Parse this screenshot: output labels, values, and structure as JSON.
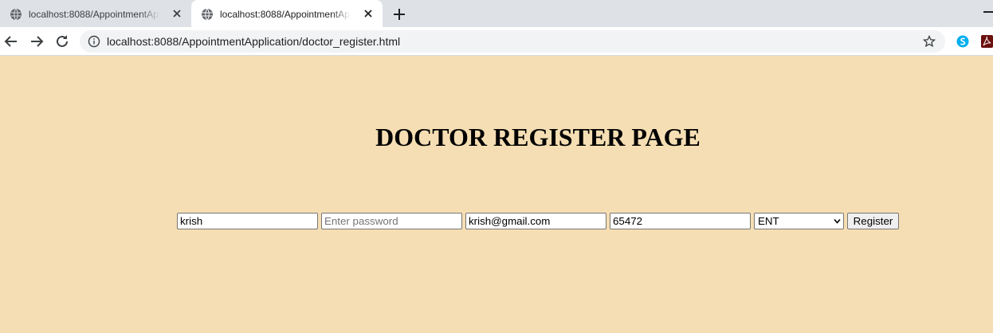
{
  "browser": {
    "tabs": [
      {
        "title": "localhost:8088/AppointmentApplication/doctor_register.html",
        "active": false
      },
      {
        "title": "localhost:8088/AppointmentApplication/doctor_register.html",
        "active": true
      }
    ],
    "url": "localhost:8088/AppointmentApplication/doctor_register.html",
    "icons": {
      "favicon": "globe-icon",
      "close": "close-icon",
      "new_tab": "plus-icon",
      "back": "arrow-left-icon",
      "forward": "arrow-right-icon",
      "reload": "reload-icon",
      "site_info": "info-icon",
      "bookmark": "star-icon",
      "extensions": [
        "skype-icon",
        "acrobat-icon"
      ]
    }
  },
  "page": {
    "background": "#f5deb3",
    "title": "DOCTOR REGISTER PAGE",
    "form": {
      "name": {
        "value": "krish",
        "placeholder": ""
      },
      "password": {
        "value": "",
        "placeholder": "Enter password"
      },
      "email": {
        "value": "krish@gmail.com",
        "placeholder": ""
      },
      "phone": {
        "value": "65472",
        "placeholder": ""
      },
      "specialization": {
        "selected": "ENT"
      },
      "submit_label": "Register"
    }
  }
}
